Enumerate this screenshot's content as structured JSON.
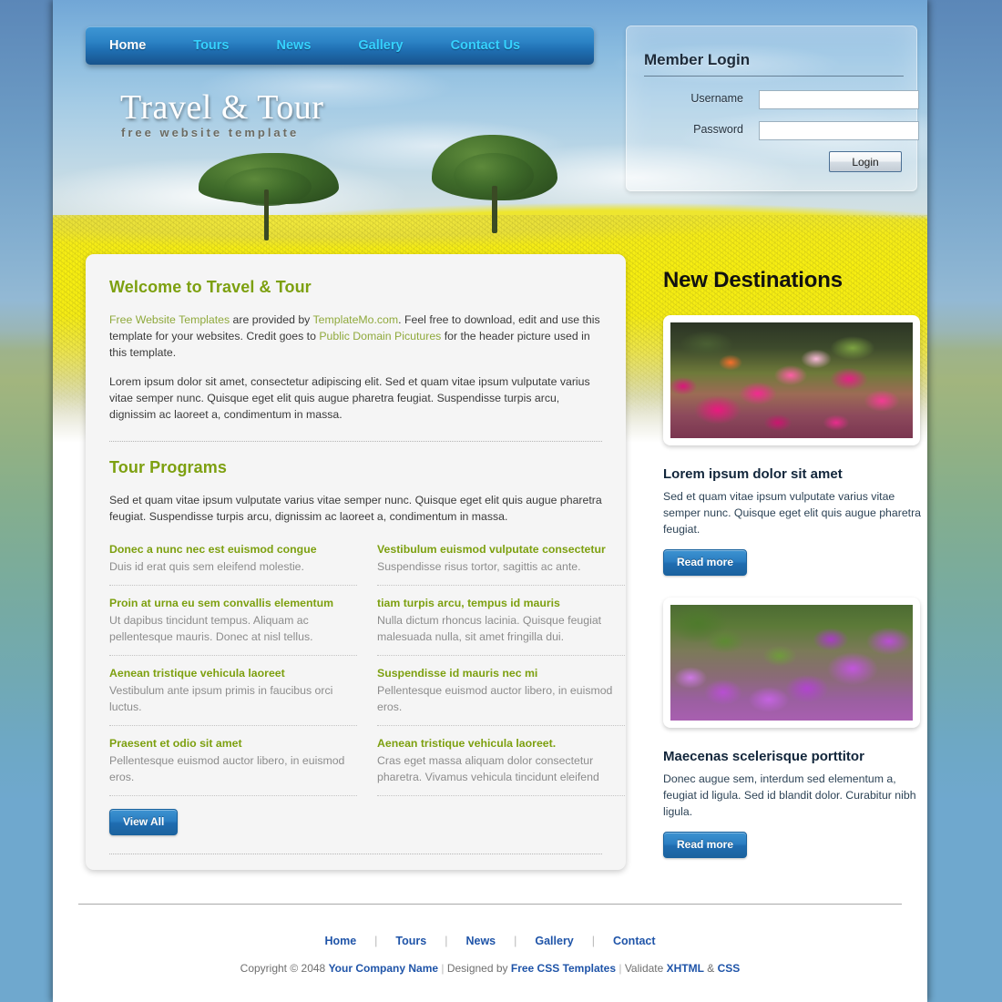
{
  "site": {
    "banner_title": "Travel & Tour",
    "banner_subtitle": "free website template"
  },
  "nav": {
    "items": [
      {
        "label": "Home",
        "active": true
      },
      {
        "label": "Tours",
        "active": false
      },
      {
        "label": "News",
        "active": false
      },
      {
        "label": "Gallery",
        "active": false
      },
      {
        "label": "Contact Us",
        "active": false
      }
    ]
  },
  "login": {
    "title": "Member Login",
    "username_label": "Username",
    "username_value": "",
    "username_placeholder": "",
    "password_label": "Password",
    "password_value": "",
    "password_placeholder": "",
    "button_label": "Login"
  },
  "welcome": {
    "heading": "Welcome to Travel & Tour",
    "para1_link1": "Free Website Templates",
    "para1_mid1": " are provided by ",
    "para1_link2": "TemplateMo.com",
    "para1_mid2": ". Feel free to download, edit and use this template for your websites. Credit goes to ",
    "para1_link3": "Public Domain Picutures",
    "para1_end": " for the header picture used in this template.",
    "para2": "Lorem ipsum dolor sit amet, consectetur adipiscing elit. Sed et quam vitae ipsum vulputate varius vitae semper nunc. Quisque eget elit quis augue pharetra feugiat. Suspendisse turpis arcu, dignissim ac laoreet a, condimentum in massa."
  },
  "programs": {
    "heading": "Tour Programs",
    "intro": "Sed et quam vitae ipsum vulputate varius vitae semper nunc. Quisque eget elit quis augue pharetra feugiat. Suspendisse turpis arcu, dignissim ac laoreet a, condimentum in massa.",
    "items": [
      {
        "title": "Donec a nunc nec est euismod congue",
        "desc": "Duis id erat quis sem eleifend molestie."
      },
      {
        "title": "Vestibulum euismod vulputate consectetur",
        "desc": "Suspendisse risus tortor, sagittis ac ante."
      },
      {
        "title": "Proin at urna eu sem convallis elementum",
        "desc": "Ut dapibus tincidunt tempus. Aliquam ac pellentesque mauris. Donec at nisl tellus."
      },
      {
        "title": "tiam turpis arcu, tempus id mauris",
        "desc": "Nulla dictum rhoncus lacinia. Quisque feugiat malesuada nulla, sit amet fringilla dui."
      },
      {
        "title": "Aenean tristique vehicula laoreet",
        "desc": "Vestibulum ante ipsum primis in faucibus orci luctus."
      },
      {
        "title": "Suspendisse id mauris nec mi",
        "desc": "Pellentesque euismod auctor libero, in euismod eros."
      },
      {
        "title": "Praesent et odio sit amet",
        "desc": "Pellentesque euismod auctor libero, in euismod eros."
      },
      {
        "title": "Aenean tristique vehicula laoreet.",
        "desc": "Cras eget massa aliquam dolor consectetur pharetra. Vivamus vehicula tincidunt eleifend"
      }
    ],
    "view_all_label": "View All"
  },
  "sidebar": {
    "heading": "New Destinations",
    "cards": [
      {
        "image": "pink-bougainvillea-photo",
        "title": "Lorem ipsum dolor sit amet",
        "desc": "Sed et quam vitae ipsum vulputate varius vitae semper nunc. Quisque eget elit quis augue pharetra feugiat.",
        "button_label": "Read more"
      },
      {
        "image": "purple-bougainvillea-photo",
        "title": "Maecenas scelerisque porttitor",
        "desc": "Donec augue sem, interdum sed elementum a, feugiat id ligula. Sed id blandit dolor. Curabitur nibh ligula.",
        "button_label": "Read more"
      }
    ]
  },
  "footer": {
    "nav": [
      "Home",
      "Tours",
      "News",
      "Gallery",
      "Contact"
    ],
    "copyright_prefix": "Copyright © 2048 ",
    "company": "Your Company Name",
    "designed_by_prefix": " Designed by ",
    "designer": "Free CSS Templates",
    "validate_prefix": " Validate ",
    "validate_xhtml": "XHTML",
    "validate_amp": " & ",
    "validate_css": "CSS"
  },
  "colors": {
    "accent_green": "#7da010",
    "accent_blue": "#1f6cb0",
    "link_blue": "#1f54a8",
    "nav_link": "#36d2ff",
    "panel_bg": "#f5f5f5"
  }
}
